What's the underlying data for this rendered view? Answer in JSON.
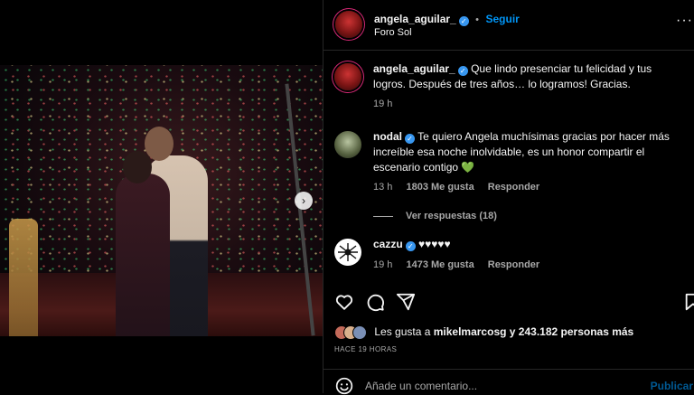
{
  "post": {
    "author": "angela_aguilar_",
    "location": "Foro Sol",
    "follow_label": "Seguir",
    "separator": "•",
    "more_label": "···",
    "next_label": "›",
    "caption": "Que lindo presenciar tu felicidad y tus logros. Después de tres años… lo logramos! Gracias.",
    "caption_time": "19 h",
    "likes_prefix": "Les gusta a",
    "likes_user": "mikelmarcosg",
    "likes_suffix": "y 243.182 personas más",
    "ago": "HACE 19 HORAS"
  },
  "comments": [
    {
      "user": "nodal",
      "text": "Te quiero Angela muchísimas gracias por hacer más increíble esa noche inolvidable, es un honor compartir el escenario contigo",
      "emoji": "💚",
      "time": "13 h",
      "likes": "1803 Me gusta",
      "reply": "Responder",
      "view_replies": "Ver respuestas (18)"
    },
    {
      "user": "cazzu",
      "text": "♥♥♥♥♥",
      "time": "19 h",
      "likes": "1473 Me gusta",
      "reply": "Responder"
    }
  ],
  "composer": {
    "placeholder": "Añade un comentario...",
    "post_label": "Publicar"
  },
  "icons": [
    "heart-icon",
    "comment-icon",
    "share-icon",
    "bookmark-icon",
    "emoji-icon",
    "verified-icon",
    "next-arrow-icon",
    "more-icon"
  ],
  "colors": {
    "link": "#0095f6",
    "verified": "#3897f0",
    "bg": "#000000",
    "text": "#f5f5f5",
    "muted": "#a8a8a8"
  }
}
